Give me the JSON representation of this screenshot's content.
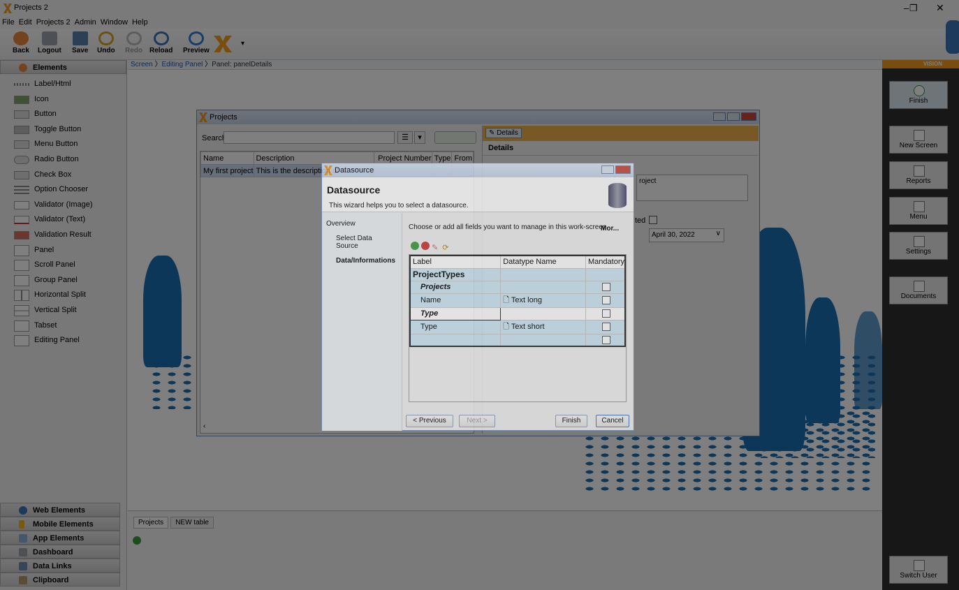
{
  "window": {
    "title": "Projects 2",
    "controls": [
      "–",
      "❐",
      "✕"
    ]
  },
  "menu": [
    "File",
    "Edit",
    "Projects 2",
    "Admin",
    "Window",
    "Help"
  ],
  "toolbar": {
    "back": "Back",
    "logout": "Logout",
    "save": "Save",
    "undo": "Undo",
    "redo": "Redo",
    "reload": "Reload",
    "preview": "Preview"
  },
  "left_panel": {
    "header": "Elements",
    "items": [
      "Label/Html",
      "Icon",
      "Button",
      "Toggle Button",
      "Menu Button",
      "Radio Button",
      "Check Box",
      "Option Chooser",
      "Validator (Image)",
      "Validator (Text)",
      "Validation Result",
      "Panel",
      "Scroll Panel",
      "Group Panel",
      "Horizontal Split",
      "Vertical Split",
      "Tabset",
      "Editing Panel"
    ],
    "sections": [
      "Web Elements",
      "Mobile Elements",
      "App Elements",
      "Dashboard",
      "Data Links",
      "Clipboard"
    ]
  },
  "breadcrumb": [
    "Screen",
    "Editing Panel",
    "Panel: panelDetails"
  ],
  "right_panel": {
    "logo": "VISION",
    "buttons": [
      "Finish",
      "New Screen",
      "Reports",
      "Menu",
      "Settings",
      "Documents"
    ],
    "switch_user": "Switch User"
  },
  "projects_window": {
    "title": "Projects",
    "search_label": "Search",
    "columns": [
      "Name",
      "Description",
      "Project Number",
      "Type",
      "From"
    ],
    "row": {
      "name": "My first project",
      "description": "This is the description of"
    },
    "details_tab": "Details",
    "details_header": "Details",
    "field_text": "roject",
    "checkbox_label": "ted",
    "date_value": "April 30, 2022"
  },
  "datasource": {
    "title": "Datasource",
    "heading": "Datasource",
    "subtitle": "This wizard helps you to select a datasource.",
    "nav": [
      "Overview",
      "Select Data Source",
      "Data/Informations"
    ],
    "instruction": "Choose or add all fields you want to manage in this work-screen.",
    "more": "Mor...",
    "columns": [
      "Label",
      "Datatype Name",
      "Mandatory"
    ],
    "rows": [
      {
        "label": "ProjectTypes",
        "datatype": "",
        "mandatory": false
      },
      {
        "label": "Projects",
        "datatype": "",
        "mandatory": false
      },
      {
        "label": "Name",
        "datatype": "Text long",
        "mandatory": false
      },
      {
        "label": "Type",
        "datatype": "",
        "mandatory": false
      },
      {
        "label": "Type",
        "datatype": "Text short",
        "mandatory": false
      },
      {
        "label": "",
        "datatype": "",
        "mandatory": false
      }
    ],
    "buttons": {
      "previous": "< Previous",
      "next": "Next >",
      "finish": "Finish",
      "cancel": "Cancel"
    }
  },
  "bottom_tabs": [
    "Projects",
    "NEW table"
  ],
  "colors": {
    "accent": "#1a6fb3",
    "orange": "#f29b1d",
    "dark_panel": "#2e2e2e"
  }
}
